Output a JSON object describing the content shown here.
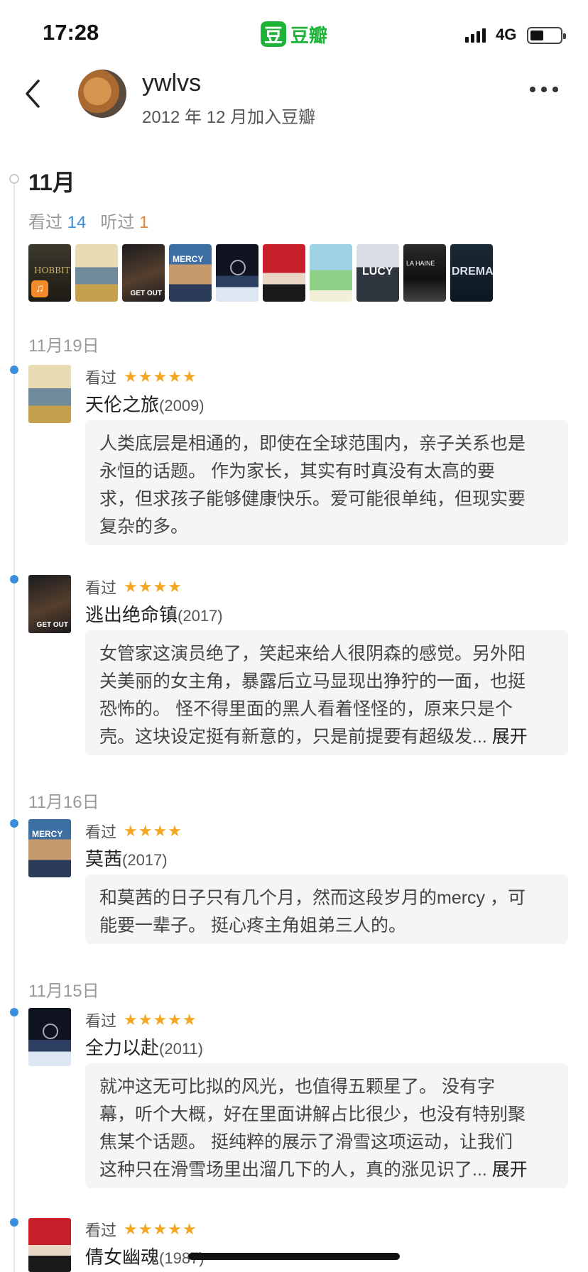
{
  "status_bar": {
    "time": "17:28",
    "app_icon_char": "豆",
    "app_name": "豆瓣",
    "network": "4G",
    "battery_level": 0.45
  },
  "profile": {
    "username": "ywlvs",
    "joined": "2012 年 12 月加入豆瓣"
  },
  "month": {
    "title": "11月",
    "watched_label": "看过",
    "watched_count": "14",
    "listened_label": "听过",
    "listened_count": "1",
    "posters": [
      "hobbit",
      "babies",
      "get-out",
      "mercy",
      "ski",
      "chinese-ghost-story",
      "anime",
      "lucy",
      "la-haine",
      "drema"
    ]
  },
  "entries": [
    {
      "date": "11月19日",
      "status": "看过",
      "stars": "★★★★★",
      "title": "天伦之旅",
      "year": "(2009)",
      "review": [
        "人类底层是相通的，即使在全球范围内，亲子关系也是",
        "永恒的话题。 作为家长，其实有时真没有太高的要",
        "求，但求孩子能够健康快乐。爱可能很单纯，但现实要",
        "复杂的多。"
      ]
    },
    {
      "status": "看过",
      "stars": "★★★★",
      "title": "逃出绝命镇",
      "year": "(2017)",
      "review": [
        "女管家这演员绝了，笑起来给人很阴森的感觉。另外阳",
        "关美丽的女主角，暴露后立马显现出狰狞的一面，也挺",
        "恐怖的。 怪不得里面的黑人看着怪怪的，原来只是个",
        "壳。这块设定挺有新意的，只是前提要有超级发..."
      ],
      "expand": "展开"
    },
    {
      "date": "11月16日",
      "status": "看过",
      "stars": "★★★★",
      "title": "莫茜",
      "year": "(2017)",
      "review": [
        "和莫茜的日子只有几个月，然而这段岁月的mercy ，可",
        "能要一辈子。 挺心疼主角姐弟三人的。"
      ]
    },
    {
      "date": "11月15日",
      "status": "看过",
      "stars": "★★★★★",
      "title": "全力以赴",
      "year": "(2011)",
      "review": [
        "就冲这无可比拟的风光，也值得五颗星了。 没有字",
        "幕，听个大概，好在里面讲解占比很少，也没有特别聚",
        "焦某个话题。 挺纯粹的展示了滑雪这项运动，让我们",
        "这种只在滑雪场里出溜几下的人，真的涨见识了..."
      ],
      "expand": "展开"
    },
    {
      "status": "看过",
      "stars": "★★★★★",
      "title": "倩女幽魂",
      "year": "(1987)"
    }
  ]
}
